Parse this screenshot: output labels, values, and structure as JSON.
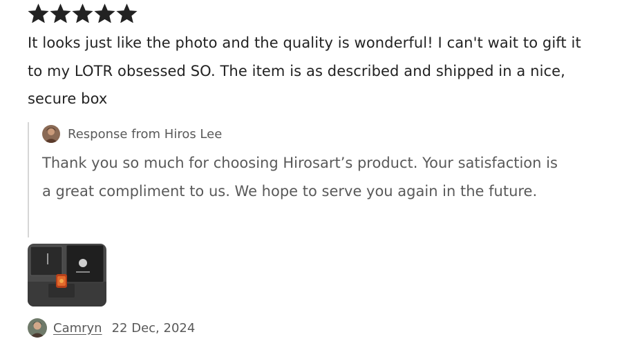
{
  "review": {
    "rating": 5,
    "rating_max": 5,
    "star_color": "#222222",
    "text": "It looks just like the photo and the quality is wonderful! I can't wait to gift it to my LOTR obsessed SO. The item is as described and shipped in a nice, secure box",
    "seller_response": {
      "header": "Response from Hiros Lee",
      "avatar_icon": "seller-avatar",
      "text": "Thank you so much for choosing Hirosart’s product. Your satisfaction is a great compliment to us. We hope to serve you again in the future."
    },
    "photo": {
      "icon": "review-photo-thumbnail"
    },
    "reviewer": {
      "name": "Camryn",
      "date": "22 Dec, 2024",
      "avatar_icon": "reviewer-avatar"
    }
  }
}
